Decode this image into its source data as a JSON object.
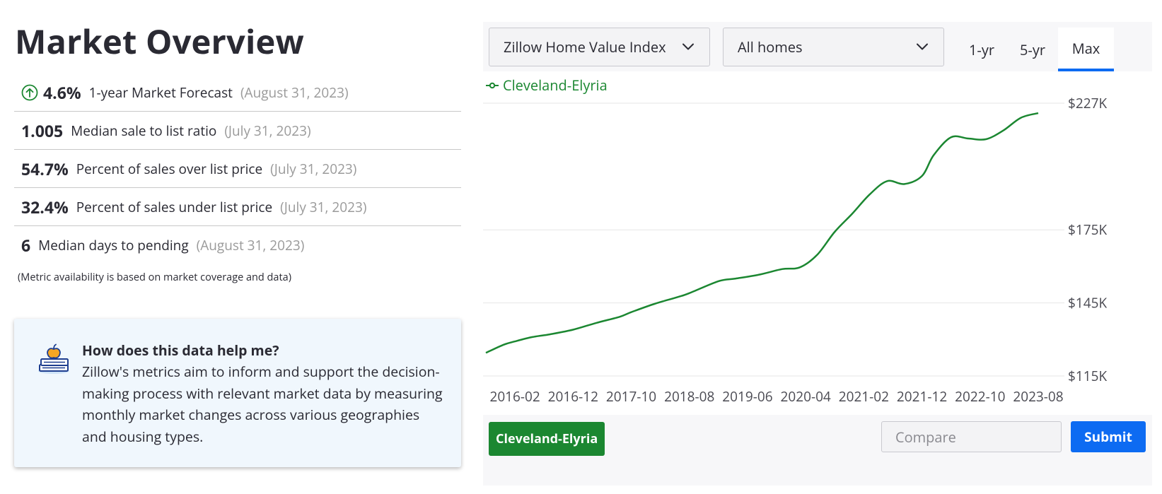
{
  "page": {
    "title": "Market Overview"
  },
  "metrics": [
    {
      "value": "4.6%",
      "label": "1-year Market Forecast",
      "date": "(August 31, 2023)",
      "icon": "arrow-up-circle-icon"
    },
    {
      "value": "1.005",
      "label": "Median sale to list ratio",
      "date": "(July 31, 2023)"
    },
    {
      "value": "54.7%",
      "label": "Percent of sales over list price",
      "date": "(July 31, 2023)"
    },
    {
      "value": "32.4%",
      "label": "Percent of sales under list price",
      "date": "(July 31, 2023)"
    },
    {
      "value": "6",
      "label": "Median days to pending",
      "date": "(August 31, 2023)"
    }
  ],
  "availability_note": "(Metric availability is based on market coverage and data)",
  "help": {
    "icon": "books-apple-icon",
    "title": "How does this data help me?",
    "body": "Zillow's metrics aim to inform and support the decision-making process with relevant market data by measuring monthly market changes across various geographies and housing types."
  },
  "toolbar": {
    "metric_select": "Zillow Home Value Index",
    "home_type_select": "All homes",
    "ranges": [
      {
        "label": "1-yr",
        "active": false
      },
      {
        "label": "5-yr",
        "active": false
      },
      {
        "label": "Max",
        "active": true
      }
    ]
  },
  "compare": {
    "region_chip": "Cleveland-Elyria",
    "placeholder": "Compare",
    "submit_label": "Submit"
  },
  "colors": {
    "series": "#1b8731",
    "accent": "#0d6bf2",
    "text": "#2a2a33",
    "muted": "#9a9a9a"
  },
  "chart_data": {
    "type": "line",
    "series": [
      {
        "name": "Cleveland-Elyria",
        "x": [
          "2015-09",
          "2015-12",
          "2016-02",
          "2016-05",
          "2016-08",
          "2016-12",
          "2017-04",
          "2017-08",
          "2017-10",
          "2018-02",
          "2018-06",
          "2018-08",
          "2019-01",
          "2019-04",
          "2019-08",
          "2019-12",
          "2020-03",
          "2020-06",
          "2020-09",
          "2020-12",
          "2021-03",
          "2021-06",
          "2021-09",
          "2021-12",
          "2022-02",
          "2022-05",
          "2022-08",
          "2022-11",
          "2023-02",
          "2023-05",
          "2023-08"
        ],
        "values": [
          124.5,
          127.8,
          129.2,
          131.0,
          132.1,
          134.0,
          136.8,
          139.3,
          141.2,
          144.6,
          147.4,
          149.0,
          153.9,
          155.0,
          156.6,
          158.9,
          159.6,
          164.8,
          174.2,
          181.6,
          189.5,
          195.0,
          193.8,
          197.1,
          205.6,
          213.0,
          212.5,
          212.2,
          215.8,
          221.0,
          222.9
        ]
      }
    ],
    "x_ticks": [
      "2016-02",
      "2016-12",
      "2017-10",
      "2018-08",
      "2019-06",
      "2020-04",
      "2021-02",
      "2021-12",
      "2022-10",
      "2023-08"
    ],
    "y_ticks": [
      {
        "value": 115,
        "label": "$115K"
      },
      {
        "value": 145,
        "label": "$145K"
      },
      {
        "value": 175,
        "label": "$175K"
      },
      {
        "value": 227,
        "label": "$227K"
      }
    ],
    "ylim": [
      115,
      227
    ],
    "y_axis_position": "right",
    "grid": true,
    "legend_placement": "top-left",
    "title": "",
    "xlabel": "",
    "ylabel": ""
  }
}
